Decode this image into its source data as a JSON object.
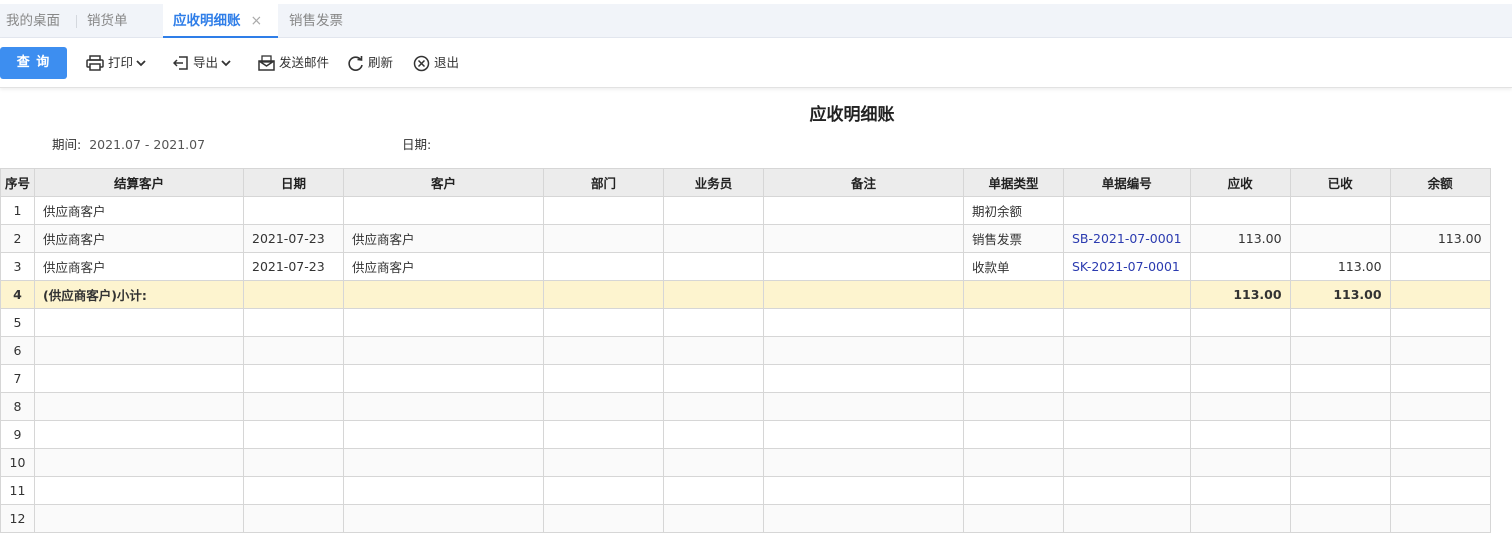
{
  "tabs": [
    {
      "label": "我的桌面",
      "active": false
    },
    {
      "label": "销货单",
      "active": false
    },
    {
      "label": "应收明细账",
      "active": true
    },
    {
      "label": "销售发票",
      "active": false
    }
  ],
  "tab_close": "×",
  "toolbar": {
    "query": "查 询",
    "print": "打印",
    "export": "导出",
    "email": "发送邮件",
    "refresh": "刷新",
    "exit": "退出"
  },
  "report": {
    "title": "应收明细账",
    "period_label": "期间:",
    "period_value": "2021.07 - 2021.07",
    "date_label": "日期:"
  },
  "table": {
    "columns": [
      "序号",
      "结算客户",
      "日期",
      "客户",
      "部门",
      "业务员",
      "备注",
      "单据类型",
      "单据编号",
      "应收",
      "已收",
      "余额"
    ],
    "rows": [
      {
        "seq": "1",
        "settle": "供应商客户",
        "date": "",
        "customer": "",
        "dept": "",
        "sales": "",
        "remark": "",
        "type": "期初余额",
        "no": "",
        "recv": "",
        "paid": "",
        "balance": ""
      },
      {
        "seq": "2",
        "settle": "供应商客户",
        "date": "2021-07-23",
        "customer": "供应商客户",
        "dept": "",
        "sales": "",
        "remark": "",
        "type": "销售发票",
        "no": "SB-2021-07-0001",
        "recv": "113.00",
        "paid": "",
        "balance": "113.00"
      },
      {
        "seq": "3",
        "settle": "供应商客户",
        "date": "2021-07-23",
        "customer": "供应商客户",
        "dept": "",
        "sales": "",
        "remark": "",
        "type": "收款单",
        "no": "SK-2021-07-0001",
        "recv": "",
        "paid": "113.00",
        "balance": ""
      },
      {
        "seq": "4",
        "settle": "(供应商客户)小计:",
        "date": "",
        "customer": "",
        "dept": "",
        "sales": "",
        "remark": "",
        "type": "",
        "no": "",
        "recv": "113.00",
        "paid": "113.00",
        "balance": "",
        "subtotal": true
      },
      {
        "seq": "5"
      },
      {
        "seq": "6"
      },
      {
        "seq": "7"
      },
      {
        "seq": "8"
      },
      {
        "seq": "9"
      },
      {
        "seq": "10"
      },
      {
        "seq": "11"
      },
      {
        "seq": "12"
      }
    ]
  },
  "colors": {
    "accent": "#3d8ef0",
    "link": "#2b3bb0",
    "subtotal_bg": "#fdf4cf",
    "header_bg": "#ececec"
  }
}
